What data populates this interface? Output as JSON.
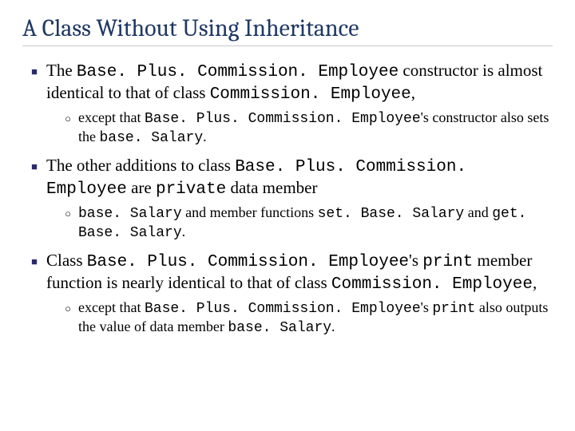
{
  "title": "A Class Without Using Inheritance",
  "items": [
    {
      "pre": "The ",
      "code1": "Base. Plus. Commission. Employee",
      "mid1": " constructor is almost identical to that of class ",
      "code2": "Commission. Employee",
      "post": ",",
      "sub": {
        "pre": "except that ",
        "code1": "Base. Plus. Commission. Employee",
        "mid1": "'s constructor also sets the ",
        "code2": "base. Salary",
        "post": "."
      }
    },
    {
      "pre": "The other additions to class ",
      "code1": "Base. Plus. Commission. Employee",
      "mid1": " are ",
      "code2": "private",
      "post": " data member",
      "sub": {
        "code1": "base. Salary",
        "mid1": " and member functions ",
        "code2": "set. Base. Salary",
        "mid2": " and ",
        "code3": "get. Base. Salary",
        "post": "."
      }
    },
    {
      "pre": "Class ",
      "code1": "Base. Plus. Commission. Employee",
      "mid1": "'s ",
      "code2": "print",
      "mid2": " member function is nearly identical to that of class ",
      "code3": "Commission. Employee",
      "post": ",",
      "sub": {
        "pre": "except that ",
        "code1": "Base. Plus. Commission. Employee",
        "mid1": "'s ",
        "code2": "print",
        "mid2": " also outputs the value of data member ",
        "code3": "base. Salary",
        "post": "."
      }
    }
  ]
}
